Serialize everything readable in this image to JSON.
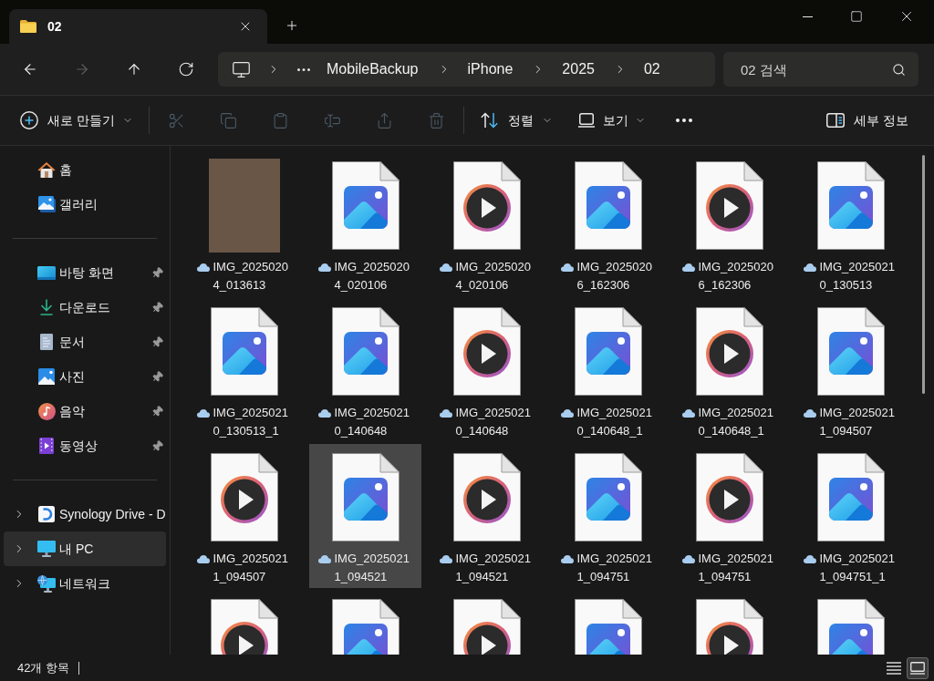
{
  "tab": {
    "title": "02"
  },
  "nav_buttons": [
    {
      "disabled": false
    },
    {
      "disabled": true
    },
    {
      "disabled": false
    },
    {
      "disabled": false
    }
  ],
  "address_bar": {
    "segments": [
      "MobileBackup",
      "iPhone",
      "2025",
      "02"
    ]
  },
  "search": {
    "placeholder": "02 검색"
  },
  "toolbar": {
    "new_label": "새로 만들기",
    "actions": [
      {
        "disabled": true
      },
      {
        "disabled": true
      },
      {
        "disabled": true
      },
      {
        "disabled": true
      },
      {
        "disabled": true
      },
      {
        "disabled": true
      }
    ],
    "sort_label": "정렬",
    "view_label": "보기",
    "details_label": "세부 정보"
  },
  "sidebar": {
    "sections": [
      {
        "items": [
          {
            "label": "홈",
            "selected": false
          },
          {
            "label": "갤러리",
            "selected": false
          }
        ]
      },
      {
        "items": [
          {
            "label": "바탕 화면",
            "pinned": true,
            "selected": false
          },
          {
            "label": "다운로드",
            "pinned": true,
            "selected": false
          },
          {
            "label": "문서",
            "pinned": true,
            "selected": false
          },
          {
            "label": "사진",
            "pinned": true,
            "selected": false
          },
          {
            "label": "음악",
            "pinned": true,
            "selected": false
          },
          {
            "label": "동영상",
            "pinned": true,
            "selected": false
          }
        ]
      },
      {
        "items": [
          {
            "label": "Synology Drive - D",
            "expanded": false,
            "selected": false
          },
          {
            "label": "내 PC",
            "expanded": false,
            "selected": true
          },
          {
            "label": "네트워크",
            "expanded": false,
            "selected": false
          }
        ]
      }
    ]
  },
  "files": [
    {
      "kind": "photo",
      "name": "IMG_20250204_013613",
      "selected": false
    },
    {
      "kind": "image",
      "name": "IMG_20250204_020106",
      "selected": false
    },
    {
      "kind": "video",
      "name": "IMG_20250204_020106",
      "selected": false
    },
    {
      "kind": "image",
      "name": "IMG_20250206_162306",
      "selected": false
    },
    {
      "kind": "video",
      "name": "IMG_20250206_162306",
      "selected": false
    },
    {
      "kind": "image",
      "name": "IMG_20250210_130513",
      "selected": false
    },
    {
      "kind": "image",
      "name": "IMG_20250210_130513_1",
      "selected": false
    },
    {
      "kind": "image",
      "name": "IMG_20250210_140648",
      "selected": false
    },
    {
      "kind": "video",
      "name": "IMG_20250210_140648",
      "selected": false
    },
    {
      "kind": "image",
      "name": "IMG_20250210_140648_1",
      "selected": false
    },
    {
      "kind": "video",
      "name": "IMG_20250210_140648_1",
      "selected": false
    },
    {
      "kind": "image",
      "name": "IMG_20250211_094507",
      "selected": false
    },
    {
      "kind": "video",
      "name": "IMG_20250211_094507",
      "selected": false
    },
    {
      "kind": "image",
      "name": "IMG_20250211_094521",
      "selected": true
    },
    {
      "kind": "video",
      "name": "IMG_20250211_094521",
      "selected": false
    },
    {
      "kind": "image",
      "name": "IMG_20250211_094751",
      "selected": false
    },
    {
      "kind": "video",
      "name": "IMG_20250211_094751",
      "selected": false
    },
    {
      "kind": "image",
      "name": "IMG_20250211_094751_1",
      "selected": false
    },
    {
      "kind": "video",
      "selected": false
    },
    {
      "kind": "image",
      "selected": false
    },
    {
      "kind": "video",
      "selected": false
    },
    {
      "kind": "image",
      "selected": false
    },
    {
      "kind": "video",
      "selected": false
    },
    {
      "kind": "image",
      "selected": false
    }
  ],
  "status_bar": {
    "item_count": "42개 항목",
    "view_buttons": [
      {
        "selected": false
      },
      {
        "selected": true
      }
    ]
  }
}
